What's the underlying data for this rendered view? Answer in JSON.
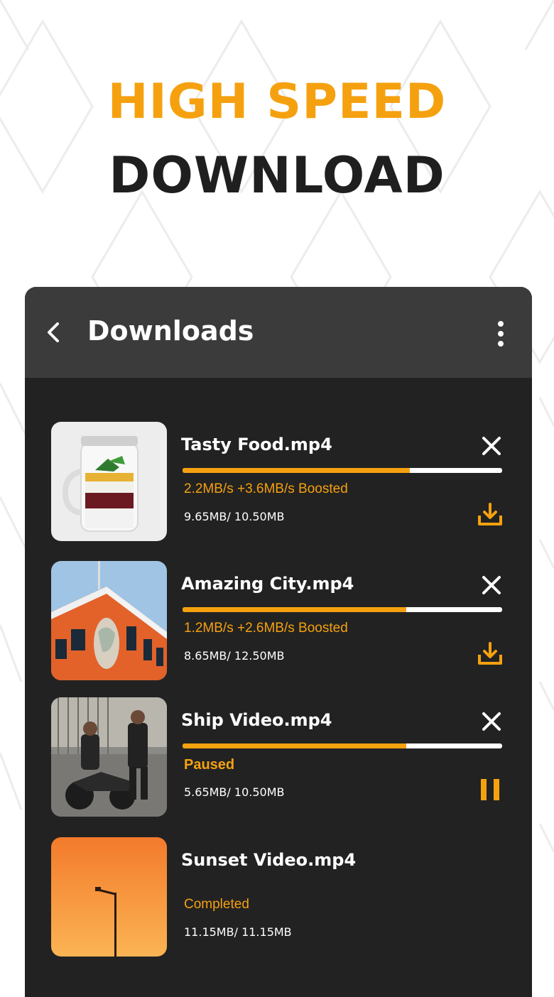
{
  "headline": {
    "line1": "HIGH SPEED",
    "line2": "DOWNLOAD"
  },
  "colors": {
    "accent": "#f5a10f",
    "panel": "#222222",
    "appbar": "#3b3b3b",
    "text_dark": "#1f1f1f"
  },
  "appbar": {
    "title": "Downloads",
    "back_icon": "chevron-left-icon",
    "menu_icon": "more-vert-icon"
  },
  "downloads": [
    {
      "name": "Tasty Food.mp4",
      "progress": 0.71,
      "status": "2.2MB/s  +3.6MB/s Boosted",
      "size": "9.65MB/ 10.50MB",
      "action_icon": "download-icon",
      "cancelable": true,
      "thumb": "food-jar"
    },
    {
      "name": "Amazing City.mp4",
      "progress": 0.7,
      "status": "1.2MB/s  +2.6MB/s Boosted",
      "size": "8.65MB/ 12.50MB",
      "action_icon": "download-icon",
      "cancelable": true,
      "thumb": "city-building"
    },
    {
      "name": "Ship Video.mp4",
      "progress": 0.7,
      "status": "Paused",
      "size": "5.65MB/ 10.50MB",
      "action_icon": "pause-icon",
      "cancelable": true,
      "thumb": "people-motorbike"
    },
    {
      "name": "Sunset Video.mp4",
      "progress": null,
      "status": "Completed",
      "size": "11.15MB/ 11.15MB",
      "action_icon": null,
      "cancelable": false,
      "thumb": "sunset-lamp"
    }
  ]
}
